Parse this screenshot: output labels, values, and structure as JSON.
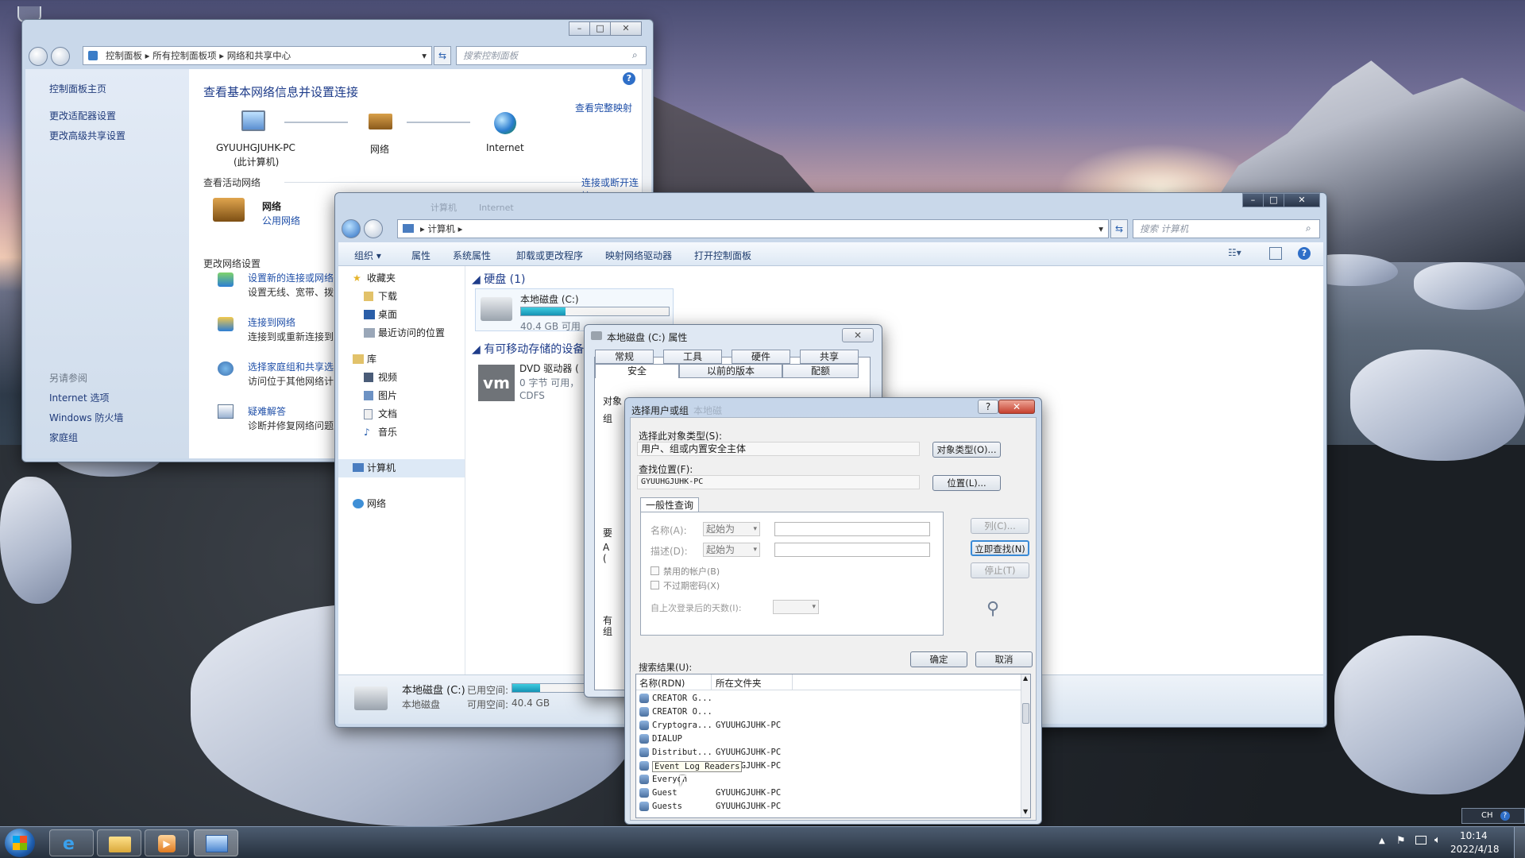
{
  "cp": {
    "breadcrumb": [
      "控制面板",
      "所有控制面板项",
      "网络和共享中心"
    ],
    "search_placeholder": "搜索控制面板",
    "sidebar": [
      "控制面板主页",
      "更改适配器设置",
      "更改高级共享设置"
    ],
    "see_also_title": "另请参阅",
    "see_also": [
      "Internet 选项",
      "Windows 防火墙",
      "家庭组"
    ],
    "heading": "查看基本网络信息并设置连接",
    "full_map": "查看完整映射",
    "node_pc": "GYUUHGJUHK-PC",
    "node_pc_sub": "(此计算机)",
    "node_net": "网络",
    "node_inet": "Internet",
    "active_title": "查看活动网络",
    "connect": "连接或断开连接",
    "net_name": "网络",
    "net_type": "公用网络",
    "change_title": "更改网络设置",
    "tasks": [
      {
        "title": "设置新的连接或网络",
        "desc": "设置无线、宽带、拨"
      },
      {
        "title": "连接到网络",
        "desc": "连接到或重新连接到"
      },
      {
        "title": "选择家庭组和共享选",
        "desc": "访问位于其他网络计"
      },
      {
        "title": "疑难解答",
        "desc": "诊断并修复网络问题"
      }
    ]
  },
  "exp": {
    "ghost": [
      "计算机",
      "Internet"
    ],
    "breadcrumb": "计算机",
    "search_placeholder": "搜索 计算机",
    "toolbar": [
      "组织",
      "属性",
      "系统属性",
      "卸载或更改程序",
      "映射网络驱动器",
      "打开控制面板"
    ],
    "nav": {
      "fav": "收藏夹",
      "fav_items": [
        "下载",
        "桌面",
        "最近访问的位置"
      ],
      "lib": "库",
      "lib_items": [
        "视频",
        "图片",
        "文档",
        "音乐"
      ],
      "computer": "计算机",
      "network": "网络"
    },
    "hdd_group": "硬盘 (1)",
    "drive_name": "本地磁盘 (C:)",
    "drive_free": "40.4 GB 可用",
    "drive_fill": 0.3,
    "removable_group": "有可移动存储的设备",
    "dvd_name": "DVD 驱动器 (",
    "dvd_free": "0 字节 可用，",
    "dvd_fs": "CDFS",
    "status": {
      "name": "本地磁盘 (C:)",
      "used_label": "已用空间:",
      "type": "本地磁盘",
      "free_label": "可用空间:",
      "free": "40.4 GB"
    }
  },
  "props": {
    "title": "本地磁盘 (C:) 属性",
    "tabs_row1": [
      "常规",
      "工具",
      "硬件",
      "共享"
    ],
    "tabs_row2": [
      "安全",
      "以前的版本",
      "配额"
    ],
    "frag": [
      "对象",
      "组",
      "要",
      "A",
      "(",
      "有",
      "组"
    ]
  },
  "sel": {
    "title": "选择用户或组",
    "ghost": "本地磁",
    "type_label": "选择此对象类型(S):",
    "type_value": "用户、组或内置安全主体",
    "type_btn": "对象类型(O)...",
    "loc_label": "查找位置(F):",
    "loc_value": "GYUUHGJUHK-PC",
    "loc_btn": "位置(L)...",
    "tab": "一般性查询",
    "name_label": "名称(A):",
    "desc_label": "描述(D):",
    "starts_with": "起始为",
    "disabled": "禁用的帐户(B)",
    "noexpire": "不过期密码(X)",
    "days_label": "自上次登录后的天数(I):",
    "col_btn": "列(C)...",
    "find_btn": "立即查找(N)",
    "stop_btn": "停止(T)",
    "ok": "确定",
    "cancel": "取消",
    "results_label": "搜索结果(U):",
    "col_name": "名称(RDN)",
    "col_folder": "所在文件夹",
    "rows": [
      {
        "name": "CREATOR G...",
        "folder": ""
      },
      {
        "name": "CREATOR O...",
        "folder": ""
      },
      {
        "name": "Cryptogra...",
        "folder": "GYUUHGJUHK-PC"
      },
      {
        "name": "DIALUP",
        "folder": ""
      },
      {
        "name": "Distribut...",
        "folder": "GYUUHGJUHK-PC"
      },
      {
        "name": "Event Log Readers",
        "folder": "GYUUHGJUHK-PC"
      },
      {
        "name": "Everyon",
        "folder": ""
      },
      {
        "name": "Guest",
        "folder": "GYUUHGJUHK-PC"
      },
      {
        "name": "Guests",
        "folder": "GYUUHGJUHK-PC"
      }
    ]
  },
  "tray": {
    "lang": "CH",
    "time": "10:14",
    "date": "2022/4/18"
  }
}
